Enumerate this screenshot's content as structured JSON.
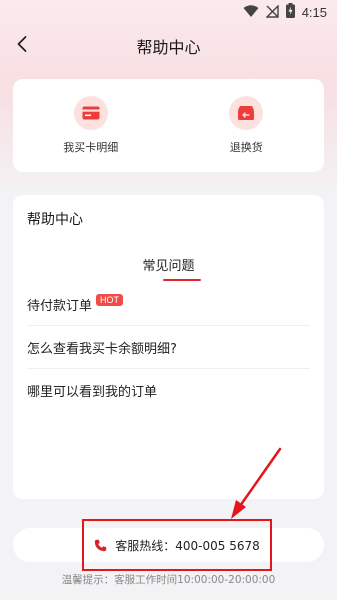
{
  "status_bar": {
    "time": "4:15"
  },
  "nav": {
    "title": "帮助中心"
  },
  "quick_actions": [
    {
      "label": "我买卡明细",
      "icon": "card-icon"
    },
    {
      "label": "退换货",
      "icon": "return-box-icon"
    }
  ],
  "help": {
    "title": "帮助中心",
    "tab": "常见问题",
    "faqs": [
      {
        "text": "待付款订单",
        "badge": "HOT"
      },
      {
        "text": "怎么查看我买卡余额明细?"
      },
      {
        "text": "哪里可以看到我的订单"
      }
    ]
  },
  "hotline": {
    "label": "客服热线：400-005 5678"
  },
  "tip": "温馨提示：客服工作时间10:00:00-20:00:00",
  "colors": {
    "accent": "#e0242e",
    "icon_bg": "#fde1df",
    "icon_fg": "#ee3b3b"
  }
}
